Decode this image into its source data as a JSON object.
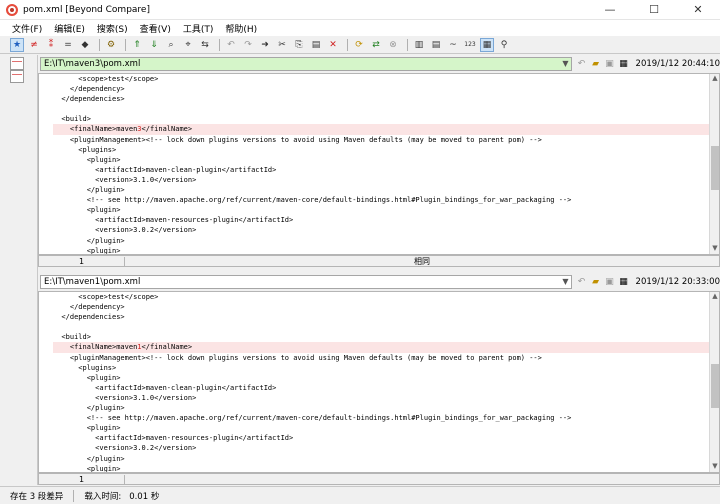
{
  "window": {
    "title": "pom.xml  [Beyond Compare]",
    "minimize": "—",
    "maximize": "☐",
    "close": "✕"
  },
  "menu": [
    "文件(F)",
    "编辑(E)",
    "搜索(S)",
    "查看(V)",
    "工具(T)",
    "帮助(H)"
  ],
  "top_pane": {
    "path": "E:\\IT\\maven3\\pom.xml",
    "timestamp": "2019/1/12 20:44:10",
    "path_bg": "#d5f5c9",
    "lines": [
      {
        "text": "      <scope>test</scope>",
        "diff": false
      },
      {
        "text": "    </dependency>",
        "diff": false
      },
      {
        "text": "  </dependencies>",
        "diff": false
      },
      {
        "text": "",
        "diff": false
      },
      {
        "text": "  <build>",
        "diff": false
      },
      {
        "text": "    <finalName>maven",
        "hl": "3",
        "rest": "</finalName>",
        "diff": true
      },
      {
        "text": "    <pluginManagement><!-- lock down plugins versions to avoid using Maven defaults (may be moved to parent pom) -->",
        "diff": false
      },
      {
        "text": "      <plugins>",
        "diff": false
      },
      {
        "text": "        <plugin>",
        "diff": false
      },
      {
        "text": "          <artifactId>maven-clean-plugin</artifactId>",
        "diff": false
      },
      {
        "text": "          <version>3.1.0</version>",
        "diff": false
      },
      {
        "text": "        </plugin>",
        "diff": false
      },
      {
        "text": "        <!-- see http://maven.apache.org/ref/current/maven-core/default-bindings.html#Plugin_bindings_for_war_packaging -->",
        "diff": false
      },
      {
        "text": "        <plugin>",
        "diff": false
      },
      {
        "text": "          <artifactId>maven-resources-plugin</artifactId>",
        "diff": false
      },
      {
        "text": "          <version>3.0.2</version>",
        "diff": false
      },
      {
        "text": "        </plugin>",
        "diff": false
      },
      {
        "text": "        <plugin>",
        "diff": false
      }
    ],
    "line_number": "1",
    "status": "相同"
  },
  "bottom_pane": {
    "path": "E:\\IT\\maven1\\pom.xml",
    "timestamp": "2019/1/12 20:33:00",
    "path_bg": "#ffffff",
    "lines": [
      {
        "text": "      <scope>test</scope>",
        "diff": false
      },
      {
        "text": "    </dependency>",
        "diff": false
      },
      {
        "text": "  </dependencies>",
        "diff": false
      },
      {
        "text": "",
        "diff": false
      },
      {
        "text": "  <build>",
        "diff": false
      },
      {
        "text": "    <finalName>maven",
        "hl": "1",
        "rest": "</finalName>",
        "diff": true
      },
      {
        "text": "    <pluginManagement><!-- lock down plugins versions to avoid using Maven defaults (may be moved to parent pom) -->",
        "diff": false
      },
      {
        "text": "      <plugins>",
        "diff": false
      },
      {
        "text": "        <plugin>",
        "diff": false
      },
      {
        "text": "          <artifactId>maven-clean-plugin</artifactId>",
        "diff": false
      },
      {
        "text": "          <version>3.1.0</version>",
        "diff": false
      },
      {
        "text": "        </plugin>",
        "diff": false
      },
      {
        "text": "        <!-- see http://maven.apache.org/ref/current/maven-core/default-bindings.html#Plugin_bindings_for_war_packaging -->",
        "diff": false
      },
      {
        "text": "        <plugin>",
        "diff": false
      },
      {
        "text": "          <artifactId>maven-resources-plugin</artifactId>",
        "diff": false
      },
      {
        "text": "          <version>3.0.2</version>",
        "diff": false
      },
      {
        "text": "        </plugin>",
        "diff": false
      },
      {
        "text": "        <plugin>",
        "diff": false
      }
    ],
    "line_number": "1"
  },
  "status": {
    "diff_count": "存在 3 段差异",
    "load_time_label": "载入时间:",
    "load_time": "0.01 秒"
  }
}
